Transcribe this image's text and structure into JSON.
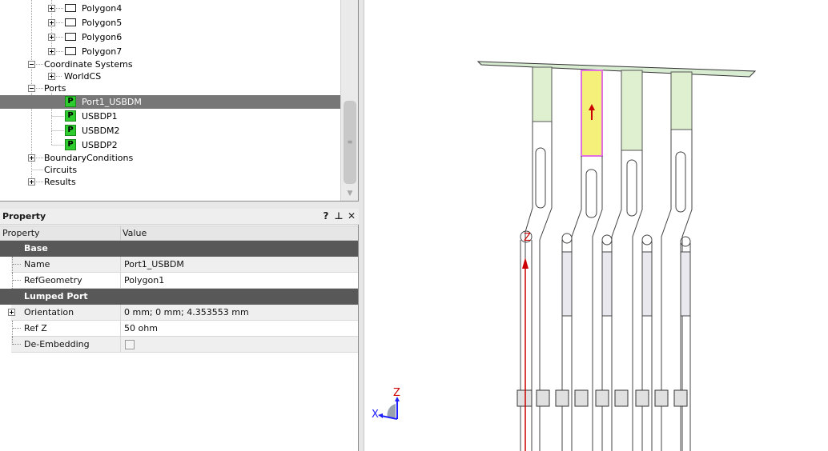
{
  "tree": {
    "items": [
      {
        "label": "Polygon4",
        "kind": "polygon"
      },
      {
        "label": "Polygon5",
        "kind": "polygon"
      },
      {
        "label": "Polygon6",
        "kind": "polygon"
      },
      {
        "label": "Polygon7",
        "kind": "polygon"
      },
      {
        "label": "Coordinate Systems",
        "kind": "folder"
      },
      {
        "label": "WorldCS",
        "kind": "cs"
      },
      {
        "label": "Ports",
        "kind": "folder"
      },
      {
        "label": "Port1_USBDM",
        "kind": "port",
        "selected": true
      },
      {
        "label": "USBDP1",
        "kind": "port"
      },
      {
        "label": "USBDM2",
        "kind": "port"
      },
      {
        "label": "USBDP2",
        "kind": "port"
      },
      {
        "label": "BoundaryConditions",
        "kind": "folder"
      },
      {
        "label": "Circuits",
        "kind": "folder"
      },
      {
        "label": "Results",
        "kind": "folder"
      }
    ],
    "port_icon_glyph": "P",
    "scroll_grip": "≡",
    "scroll_down": "▼"
  },
  "property_panel": {
    "title": "Property",
    "help_button": "?",
    "pin_button": "⊥",
    "close_button": "✕",
    "columns": {
      "name": "Property",
      "value": "Value"
    },
    "categories": [
      {
        "label": "Base",
        "rows": [
          {
            "name": "Name",
            "value": "Port1_USBDM"
          },
          {
            "name": "RefGeometry",
            "value": "Polygon1"
          }
        ]
      },
      {
        "label": "Lumped Port",
        "rows": [
          {
            "name": "Orientation",
            "value": "0 mm; 0 mm; 4.353553 mm"
          },
          {
            "name": "Ref Z",
            "value": "50 ohm"
          },
          {
            "name": "De-Embedding",
            "value": ""
          }
        ]
      }
    ]
  },
  "viewport": {
    "port_marker_label": "Z",
    "triad": {
      "z_label": "Z",
      "x_label": "X"
    },
    "colors": {
      "selection_bg": "#777777",
      "category_bg": "#585858",
      "port_icon": "#2ecc2e",
      "port_face_green": "#dff0d0",
      "port_face_selected": "#f5f07a",
      "selected_outline": "#e070e0",
      "arrow_red": "#cc0000",
      "triad_blue": "#2020ff"
    }
  }
}
